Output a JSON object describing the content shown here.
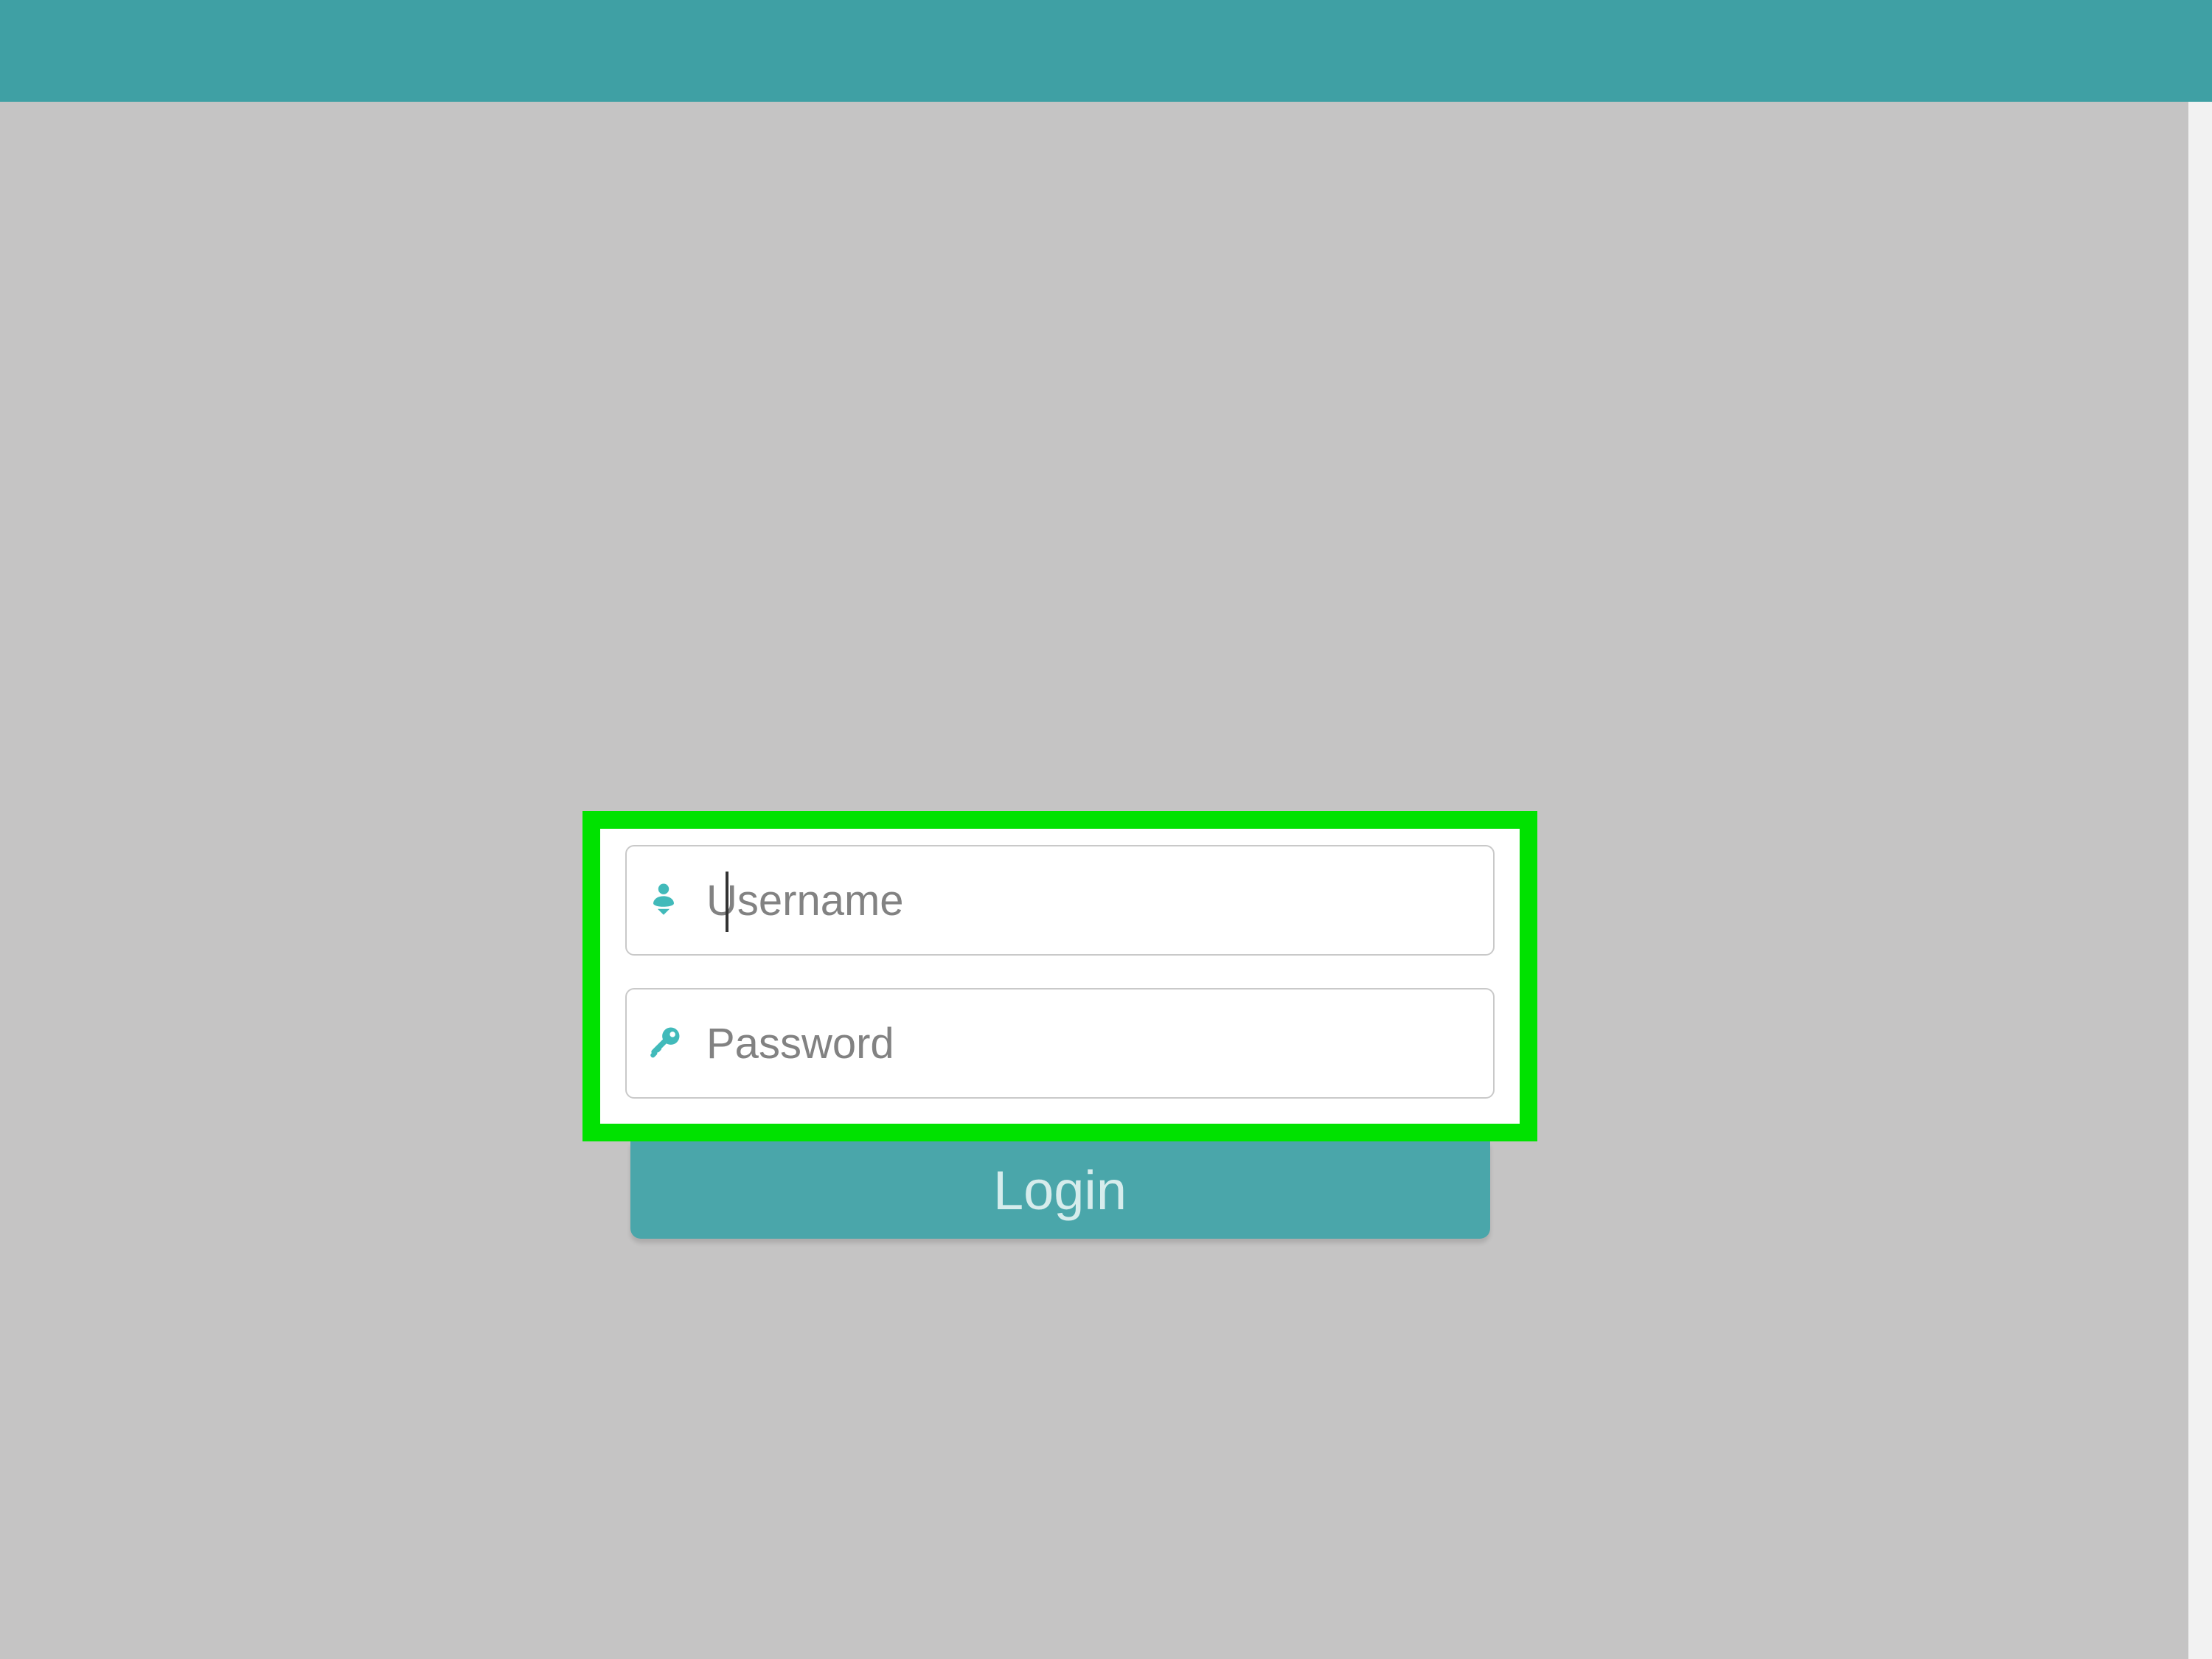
{
  "colors": {
    "header": "#3fa0a4",
    "accent": "#41baba",
    "highlight": "#00e200",
    "button": "#4aa6aa",
    "background": "#c5c4c4"
  },
  "login": {
    "username": {
      "placeholder": "Username",
      "value": "",
      "icon": "user-icon",
      "focused": true
    },
    "password": {
      "placeholder": "Password",
      "value": "",
      "icon": "key-icon",
      "focused": false
    },
    "button_label": "Login"
  }
}
